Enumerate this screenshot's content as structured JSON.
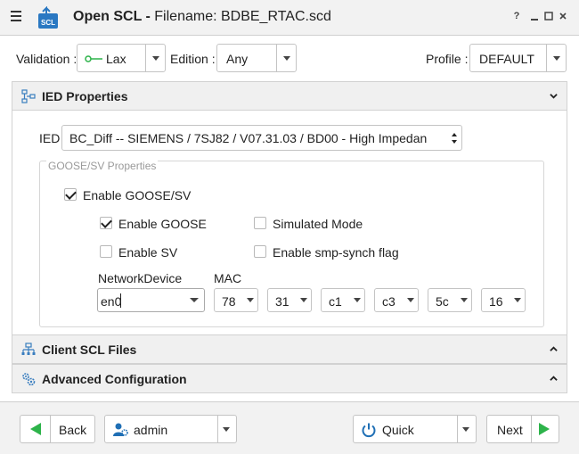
{
  "window": {
    "app_name": "Open SCL -",
    "filename_label": "Filename: BDBE_RTAC.scd",
    "help_label": "?",
    "app_icon_text": "SCL"
  },
  "toolbar": {
    "validation_label": "Validation :",
    "validation_value": "Lax",
    "edition_label": "Edition :",
    "edition_value": "Any",
    "profile_label": "Profile :",
    "profile_value": "DEFAULT"
  },
  "ied_properties": {
    "title": "IED Properties",
    "ied_label": "IED",
    "ied_value": "BC_Diff -- SIEMENS / 7SJ82 / V07.31.03 / BD00 - High Impedan",
    "goose_group": {
      "legend": "GOOSE/SV Properties",
      "enable_goose_sv": {
        "label": "Enable GOOSE/SV",
        "checked": true
      },
      "enable_goose": {
        "label": "Enable GOOSE",
        "checked": true
      },
      "simulated_mode": {
        "label": "Simulated Mode",
        "checked": false
      },
      "enable_sv": {
        "label": "Enable SV",
        "checked": false
      },
      "smp_synch": {
        "label": "Enable smp-synch flag",
        "checked": false
      },
      "network_device_label": "NetworkDevice",
      "network_device_value": "en0",
      "mac_label": "MAC",
      "mac_octets": [
        "78",
        "31",
        "c1",
        "c3",
        "5c",
        "16"
      ]
    }
  },
  "client_scl": {
    "title": "Client SCL Files"
  },
  "advanced": {
    "title": "Advanced Configuration"
  },
  "footer": {
    "back_label": "Back",
    "user_value": "admin",
    "quick_label": "Quick",
    "next_label": "Next"
  },
  "colors": {
    "accent_green": "#2db34a",
    "power_blue": "#1f6fb5",
    "icon_blue": "#3a7ebf"
  }
}
